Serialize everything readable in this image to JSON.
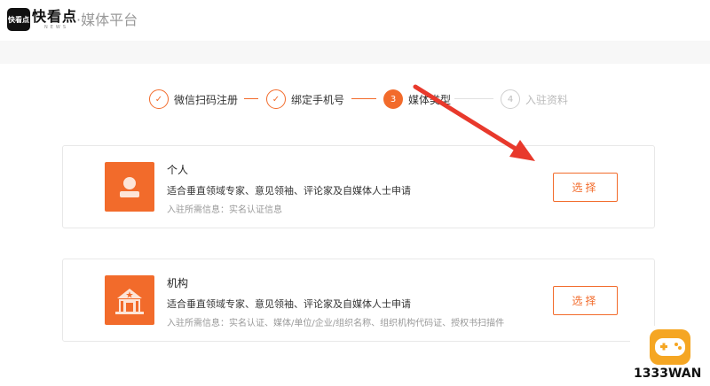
{
  "header": {
    "logo_text": "快看点",
    "brand_name": "快看点",
    "brand_sub": "NEWS",
    "platform_title": "·媒体平台"
  },
  "steps": [
    {
      "number": "✓",
      "label": "微信扫码注册",
      "state": "done"
    },
    {
      "number": "✓",
      "label": "绑定手机号",
      "state": "done"
    },
    {
      "number": "3",
      "label": "媒体类型",
      "state": "active"
    },
    {
      "number": "4",
      "label": "入驻资料",
      "state": "todo"
    }
  ],
  "cards": [
    {
      "icon": "person-icon",
      "title": "个人",
      "desc": "适合垂直领域专家、意见领袖、评论家及自媒体人士申请",
      "requirements": "入驻所需信息：实名认证信息",
      "button": "选择"
    },
    {
      "icon": "building-icon",
      "title": "机构",
      "desc": "适合垂直领域专家、意见领袖、评论家及自媒体人士申请",
      "requirements": "入驻所需信息：实名认证、媒体/单位/企业/组织名称、组织机构代码证、授权书扫描件",
      "button": "选择"
    }
  ],
  "watermark": {
    "text": "1333WAN",
    "icon": "gamepad-icon"
  },
  "colors": {
    "accent": "#f26b2b",
    "arrow": "#e8392c"
  }
}
